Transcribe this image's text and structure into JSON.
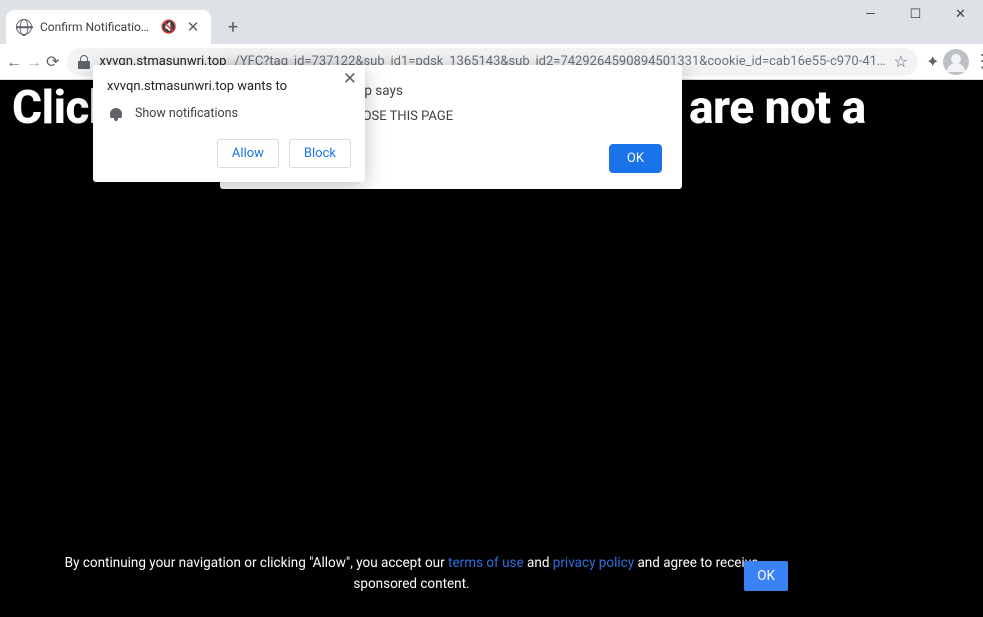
{
  "window": {
    "minimize": "—",
    "maximize": "☐",
    "close": "✕"
  },
  "tab": {
    "title": "Confirm Notifications",
    "mute_glyph": "🔇",
    "close_glyph": "✕",
    "new_tab_glyph": "+"
  },
  "toolbar": {
    "back": "←",
    "forward": "→",
    "reload": "⟳",
    "url_host": "xvvqn.stmasunwri.top",
    "url_path": "/YFC?tag_id=737122&sub_id1=pdsk_1365143&sub_id2=7429264590894501331&cookie_id=cab16e55-c970-41…",
    "star": "☆",
    "extensions_glyph": "✦",
    "menu_glyph": "⋮"
  },
  "page": {
    "headline": "Click «Allow» to confirm that you are not a"
  },
  "permission_dialog": {
    "close_glyph": "✕",
    "origin_line": "xvvqn.stmasunwri.top wants to",
    "request_label": "Show notifications",
    "allow_label": "Allow",
    "block_label": "Block"
  },
  "js_alert": {
    "title_line": "xvvqn.stmasunwri.top says",
    "body": "PRESS ALLOW TO CLOSE THIS PAGE",
    "ok_label": "OK"
  },
  "consent": {
    "prefix": "By continuing your navigation or clicking \"Allow\", you accept our ",
    "terms_label": "terms of use",
    "and": " and ",
    "privacy_label": "privacy policy",
    "suffix": " and agree to receive sponsored content.",
    "ok_label": "OK"
  }
}
